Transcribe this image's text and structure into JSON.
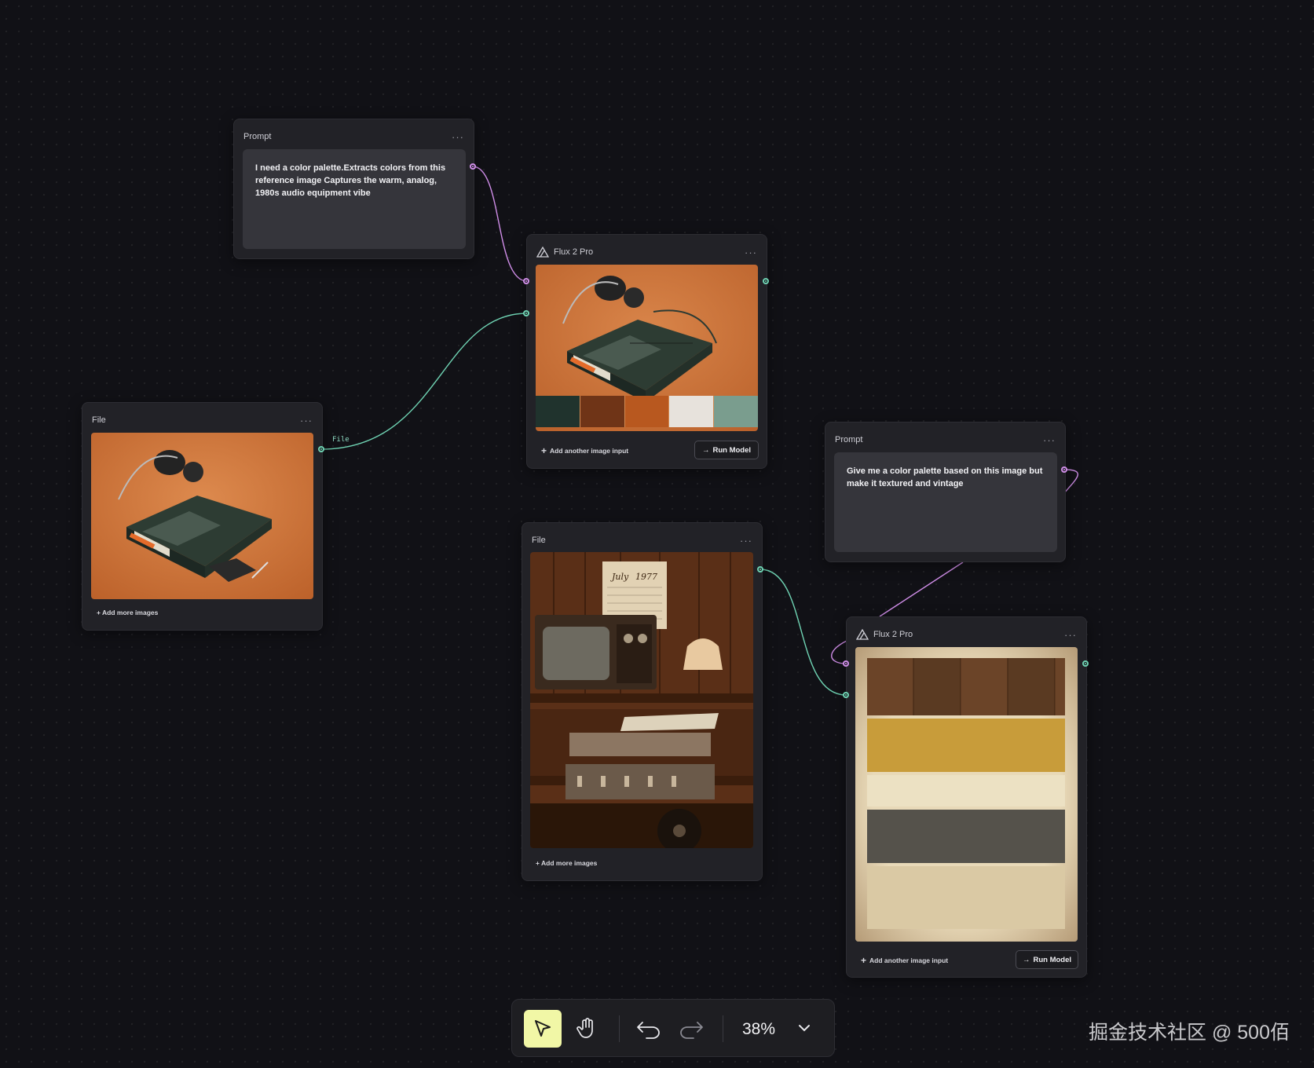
{
  "nodes": {
    "prompt1": {
      "title": "Prompt",
      "text": "I need a color palette.Extracts colors from this reference image Captures the warm, analog, 1980s audio equipment vibe"
    },
    "flux1": {
      "title": "Flux 2 Pro",
      "add_input_label": "Add another image input",
      "run_label": "Run Model",
      "palette": [
        "#20332d",
        "#6f3417",
        "#b8581f",
        "#e7e2dc",
        "#7a9d8e"
      ]
    },
    "file1": {
      "title": "File",
      "add_more_label": "+ Add more images",
      "edge_label": "File"
    },
    "prompt2": {
      "title": "Prompt",
      "text": "Give me a color palette based on this image but make it textured and vintage"
    },
    "file2": {
      "title": "File",
      "add_more_label": "+ Add more images",
      "calendar_month": "July",
      "calendar_year": "1977"
    },
    "flux2": {
      "title": "Flux 2 Pro",
      "add_input_label": "Add another image input",
      "run_label": "Run Model",
      "swatches": [
        "#5b3b22",
        "#c89c3a",
        "#ece1c3",
        "#55524b",
        "#dac9a4"
      ]
    }
  },
  "toolbar": {
    "zoom": "38%",
    "tools": [
      "select-tool",
      "hand-tool",
      "undo",
      "redo"
    ],
    "active_tool": "select-tool"
  },
  "watermark": "掘金技术社区 @ 500佰",
  "colors": {
    "canvas_bg": "#111116",
    "node_bg": "#222227",
    "edge_pink": "#d08ee8",
    "edge_green": "#6fd3b3",
    "active_tool_bg": "#f1f7a6"
  }
}
